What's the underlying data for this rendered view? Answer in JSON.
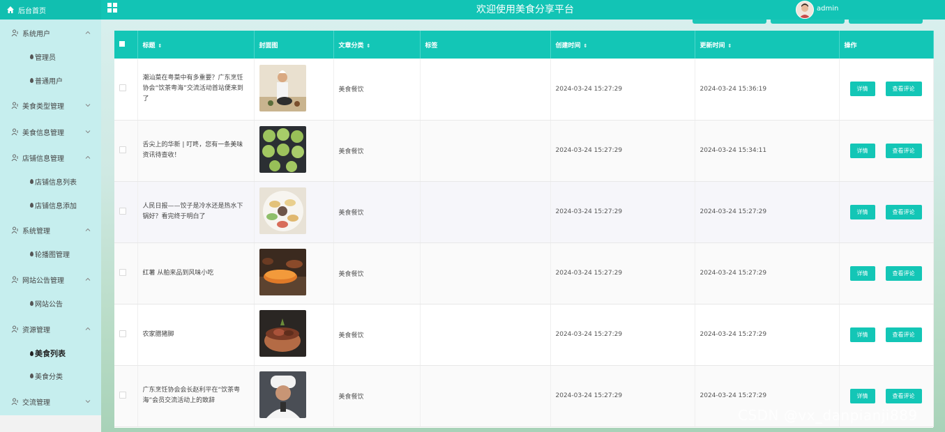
{
  "header": {
    "home_label": "后台首页",
    "welcome": "欢迎使用美食分享平台",
    "user": "admin"
  },
  "sidebar": {
    "items": [
      {
        "label": "系统用户",
        "expanded": true
      },
      {
        "label": "管理员"
      },
      {
        "label": "普通用户"
      },
      {
        "label": "美食类型管理",
        "expanded": false
      },
      {
        "label": "美食信息管理",
        "expanded": false
      },
      {
        "label": "店铺信息管理",
        "expanded": true
      },
      {
        "label": "店铺信息列表"
      },
      {
        "label": "店铺信息添加"
      },
      {
        "label": "系统管理",
        "expanded": true
      },
      {
        "label": "轮播图管理"
      },
      {
        "label": "网站公告管理",
        "expanded": true
      },
      {
        "label": "网站公告"
      },
      {
        "label": "资源管理",
        "expanded": true
      },
      {
        "label": "美食列表",
        "active": true
      },
      {
        "label": "美食分类"
      },
      {
        "label": "交流管理",
        "expanded": false
      }
    ]
  },
  "table": {
    "columns": [
      "标题",
      "封面图",
      "文章分类",
      "标签",
      "创建时间",
      "更新时间",
      "操作"
    ],
    "rows": [
      {
        "title": "潮汕菜在粤菜中有多重要？广东烹饪协会“饮茶粤海”交流活动首站便来到了",
        "category": "美食餐饮",
        "tags": "",
        "created": "2024-03-24 15:27:29",
        "updated": "2024-03-24 15:36:19"
      },
      {
        "title": "舌尖上的华新 | 叮咚，您有一条美味资讯待查收！",
        "category": "美食餐饮",
        "tags": "",
        "created": "2024-03-24 15:27:29",
        "updated": "2024-03-24 15:34:11"
      },
      {
        "title": "人民日报——饺子是冷水还是热水下锅好？看完终于明白了",
        "category": "美食餐饮",
        "tags": "",
        "created": "2024-03-24 15:27:29",
        "updated": "2024-03-24 15:27:29"
      },
      {
        "title": "红薯 从舶来品到风味小吃",
        "category": "美食餐饮",
        "tags": "",
        "created": "2024-03-24 15:27:29",
        "updated": "2024-03-24 15:27:29"
      },
      {
        "title": "农家腊猪脚",
        "category": "美食餐饮",
        "tags": "",
        "created": "2024-03-24 15:27:29",
        "updated": "2024-03-24 15:27:29"
      },
      {
        "title": "广东烹饪协会会长赵利平在“饮茶粤海”会员交流活动上的致辞",
        "category": "美食餐饮",
        "tags": "",
        "created": "2024-03-24 15:27:29",
        "updated": "2024-03-24 15:27:29"
      }
    ],
    "actions": {
      "detail": "详情",
      "comments": "查看评论"
    }
  },
  "watermark": "CSDN @vx_danpianji889",
  "colors": {
    "accent": "#13c6b6",
    "sidebar": "#c6eeee"
  }
}
